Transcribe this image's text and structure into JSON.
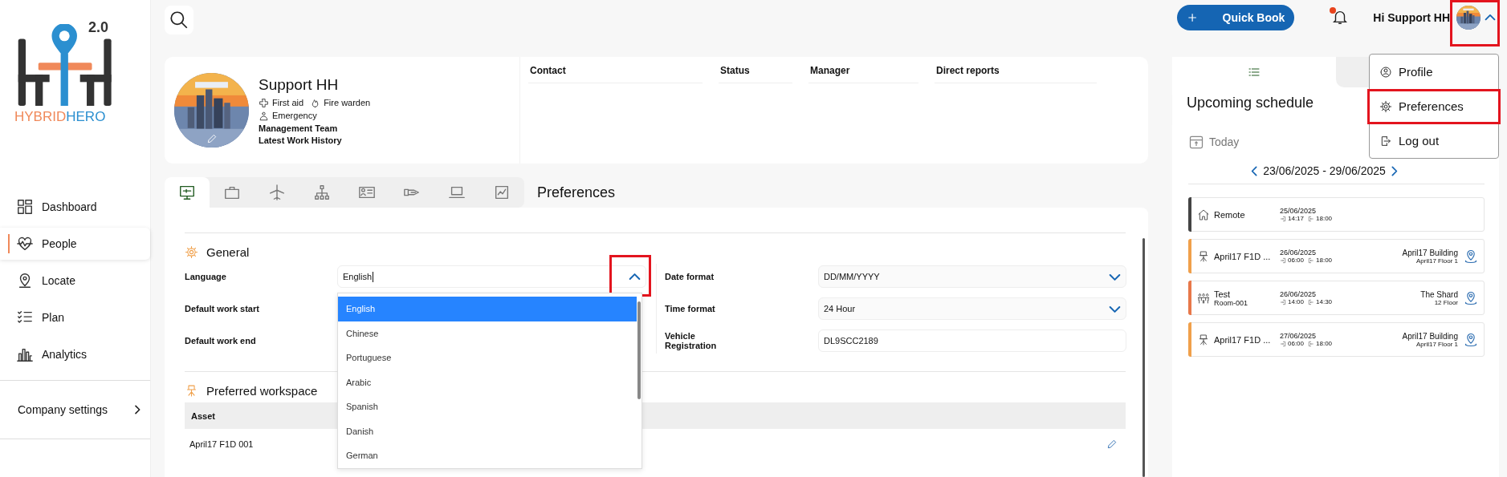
{
  "logo": {
    "version": "2.0",
    "word_left": "HYBRID",
    "word_right": "HERO"
  },
  "sidebar": {
    "items": [
      {
        "label": "Dashboard",
        "selected": false
      },
      {
        "label": "People",
        "selected": true
      },
      {
        "label": "Locate",
        "selected": false
      },
      {
        "label": "Plan",
        "selected": false
      },
      {
        "label": "Analytics",
        "selected": false
      }
    ],
    "settings": "Company settings"
  },
  "header": {
    "quick_book": "Quick Book",
    "notification": true,
    "greeting": "Hi Support HH",
    "menu_open": true,
    "highlighted": true
  },
  "user_menu": [
    {
      "label": "Profile",
      "highlighted": false
    },
    {
      "label": "Preferences",
      "highlighted": true
    },
    {
      "label": "Log out",
      "highlighted": false
    }
  ],
  "profile": {
    "name": "Support HH",
    "badges": [
      "First aid",
      "Fire warden"
    ],
    "role": "Emergency",
    "team": "Management Team",
    "history": "Latest Work History",
    "columns": [
      "Contact",
      "Status",
      "Manager",
      "Direct reports"
    ]
  },
  "tabs": [
    {
      "selected": true
    },
    {
      "selected": false
    },
    {
      "selected": false
    },
    {
      "selected": false
    },
    {
      "selected": false
    },
    {
      "selected": false
    },
    {
      "selected": false
    },
    {
      "selected": false
    }
  ],
  "page_title": "Preferences",
  "general": {
    "title": "General",
    "left": [
      {
        "label": "Language",
        "kind": "combo",
        "value": "English",
        "open": true,
        "highlighted": true
      },
      {
        "label": "Default work start",
        "kind": "covered"
      },
      {
        "label": "Default work end",
        "kind": "covered"
      }
    ],
    "right": [
      {
        "label": "Date format",
        "kind": "select",
        "value": "DD/MM/YYYY"
      },
      {
        "label": "Time format",
        "kind": "select",
        "value": "24 Hour"
      },
      {
        "label": "Vehicle Registration",
        "kind": "text",
        "value": "DL9SCC2189"
      }
    ],
    "options": [
      {
        "label": "English",
        "selected": true
      },
      {
        "label": "Chinese",
        "selected": false
      },
      {
        "label": "Portuguese",
        "selected": false
      },
      {
        "label": "Arabic",
        "selected": false
      },
      {
        "label": "Spanish",
        "selected": false
      },
      {
        "label": "Danish",
        "selected": false
      },
      {
        "label": "German",
        "selected": false
      }
    ]
  },
  "workspace": {
    "title": "Preferred workspace",
    "columns": [
      "Asset"
    ],
    "rows": [
      {
        "asset": "April17 F1D 001"
      }
    ]
  },
  "schedule": {
    "tabs": [
      {
        "selected": true
      },
      {
        "selected": false
      }
    ],
    "title": "Upcoming schedule",
    "today": "Today",
    "range_start": "23/06/2025",
    "range_sep": "-",
    "range_end": "29/06/2025",
    "items": [
      {
        "kind": "home",
        "title": "Remote",
        "date": "25/06/2025",
        "check_in": "14:17",
        "check_out": "18:00",
        "color": "#444444"
      },
      {
        "kind": "desk",
        "title": "April17 F1D ...",
        "date": "26/06/2025",
        "check_in": "06:00",
        "check_out": "18:00",
        "building": "April17 Building",
        "floor": "April17 Floor 1",
        "color": "#f0a04b"
      },
      {
        "kind": "room",
        "title": "Test",
        "subtitle": "Room-001",
        "date": "26/06/2025",
        "check_in": "14:00",
        "check_out": "14:30",
        "building": "The Shard",
        "floor": "12 Floor",
        "color": "#e8784a"
      },
      {
        "kind": "desk",
        "title": "April17 F1D ...",
        "date": "27/06/2025",
        "check_in": "06:00",
        "check_out": "18:00",
        "building": "April17 Building",
        "floor": "April17 Floor 1",
        "color": "#f0a04b"
      }
    ]
  }
}
